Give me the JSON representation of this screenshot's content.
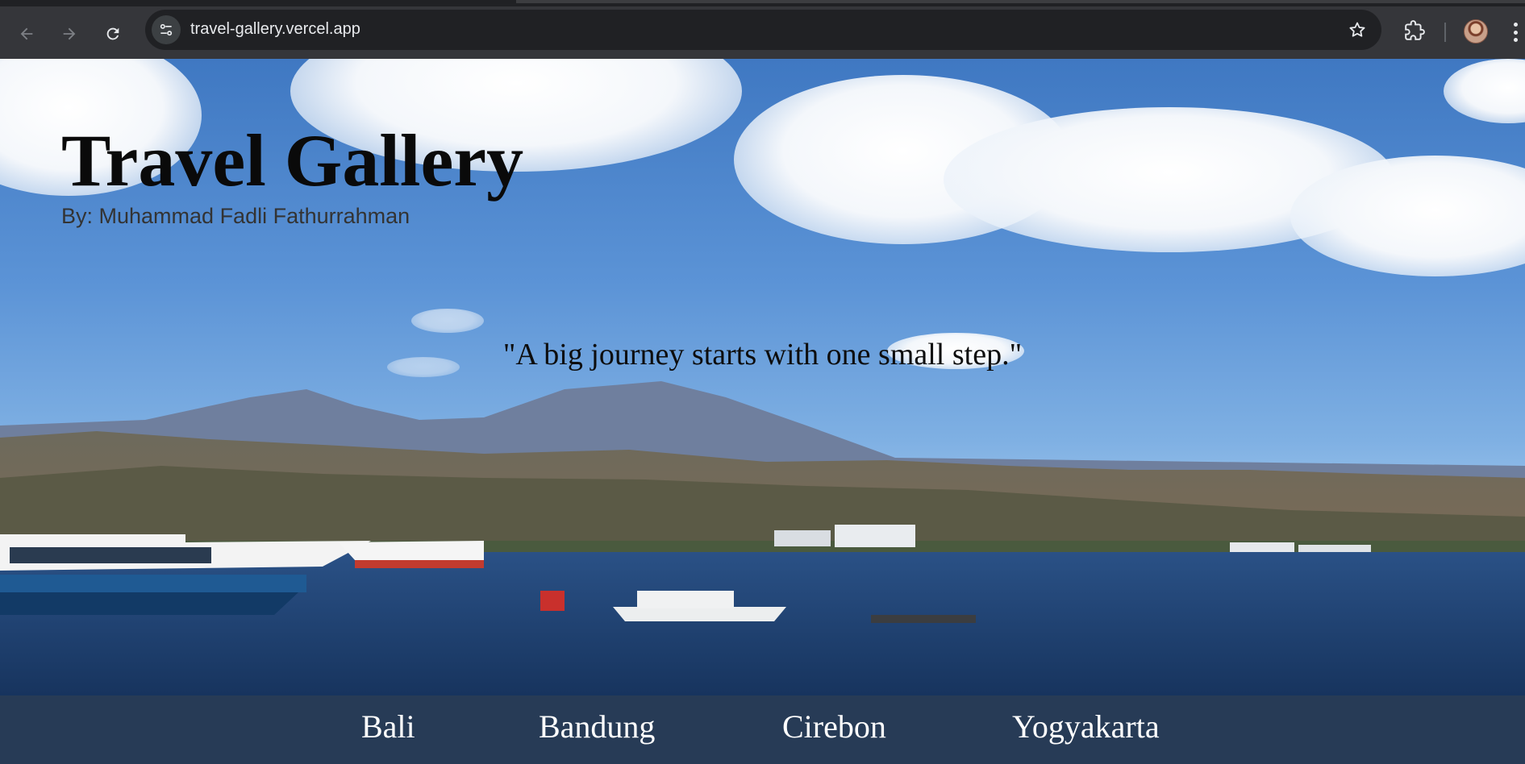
{
  "browser": {
    "url": "travel-gallery.vercel.app",
    "icons": {
      "back": "arrow-left-icon",
      "forward": "arrow-right-icon",
      "reload": "reload-icon",
      "site_info": "tune-icon",
      "bookmark": "star-icon",
      "extensions": "puzzle-icon",
      "menu": "more-vert-icon"
    }
  },
  "page": {
    "title": "Travel Gallery",
    "author": "By: Muhammad Fadli Fathurrahman",
    "quote": "\"A big journey starts with one small step.\"",
    "nav": [
      {
        "label": "Bali"
      },
      {
        "label": "Bandung"
      },
      {
        "label": "Cirebon"
      },
      {
        "label": "Yogyakarta"
      }
    ]
  },
  "colors": {
    "navbar_bg": "#273b56",
    "nav_text": "#ffffff",
    "title_text": "#0a0a0a",
    "chrome_bg": "#35363a",
    "omnibox_bg": "#202124"
  }
}
